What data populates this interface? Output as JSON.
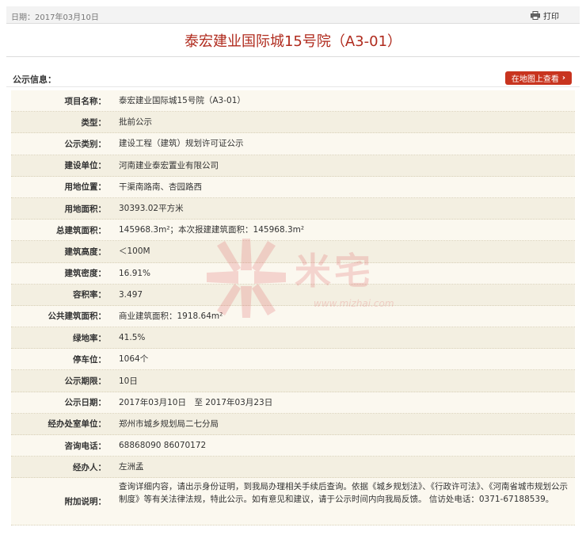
{
  "header": {
    "date": "日期：2017年03月10日",
    "print_label": "打印",
    "print_icon": "printer-icon"
  },
  "title": "泰宏建业国际城15号院（A3-01）",
  "section": {
    "label": "公示信息：",
    "map_button": "在地图上查看",
    "map_button_color": "#c8341f"
  },
  "rows": [
    {
      "label": "项目名称：",
      "value": "泰宏建业国际城15号院（A3-01）"
    },
    {
      "label": "类型：",
      "value": "批前公示"
    },
    {
      "label": "公示类别：",
      "value": "建设工程（建筑）规划许可证公示"
    },
    {
      "label": "建设单位：",
      "value": "河南建业泰宏置业有限公司"
    },
    {
      "label": "用地位置：",
      "value": "干渠南路南、杏园路西"
    },
    {
      "label": "用地面积：",
      "value": "30393.02平方米"
    },
    {
      "label": "总建筑面积：",
      "value": "145968.3m²；本次报建建筑面积：145968.3m²"
    },
    {
      "label": "建筑高度：",
      "value": "＜100M"
    },
    {
      "label": "建筑密度：",
      "value": "16.91%"
    },
    {
      "label": "容积率：",
      "value": "3.497"
    },
    {
      "label": "公共建筑面积：",
      "value": "商业建筑面积：1918.64m²"
    },
    {
      "label": "绿地率：",
      "value": "41.5%"
    },
    {
      "label": "停车位：",
      "value": "1064个"
    },
    {
      "label": "公示期限：",
      "value": "10日"
    },
    {
      "label": "公示日期：",
      "value": "2017年03月10日　至 2017年03月23日"
    },
    {
      "label": "经办处室单位：",
      "value": "郑州市城乡规划局二七分局"
    },
    {
      "label": "咨询电话：",
      "value": "68868090 86070172"
    },
    {
      "label": "经办人：",
      "value": "左洲孟"
    },
    {
      "label": "附加说明：",
      "value": "查询详细内容，请出示身份证明，到我局办理相关手续后查询。依据《城乡规划法》、《行政许可法》、《河南省城市规划公示制度》等有关法律法规，特此公示。如有意见和建议，请于公示时间内向我局反馈。 信访处电话：0371-67188539。"
    }
  ],
  "watermark": {
    "text": "米宅",
    "url": "www.mizhai.com",
    "color": "#d9363e"
  }
}
